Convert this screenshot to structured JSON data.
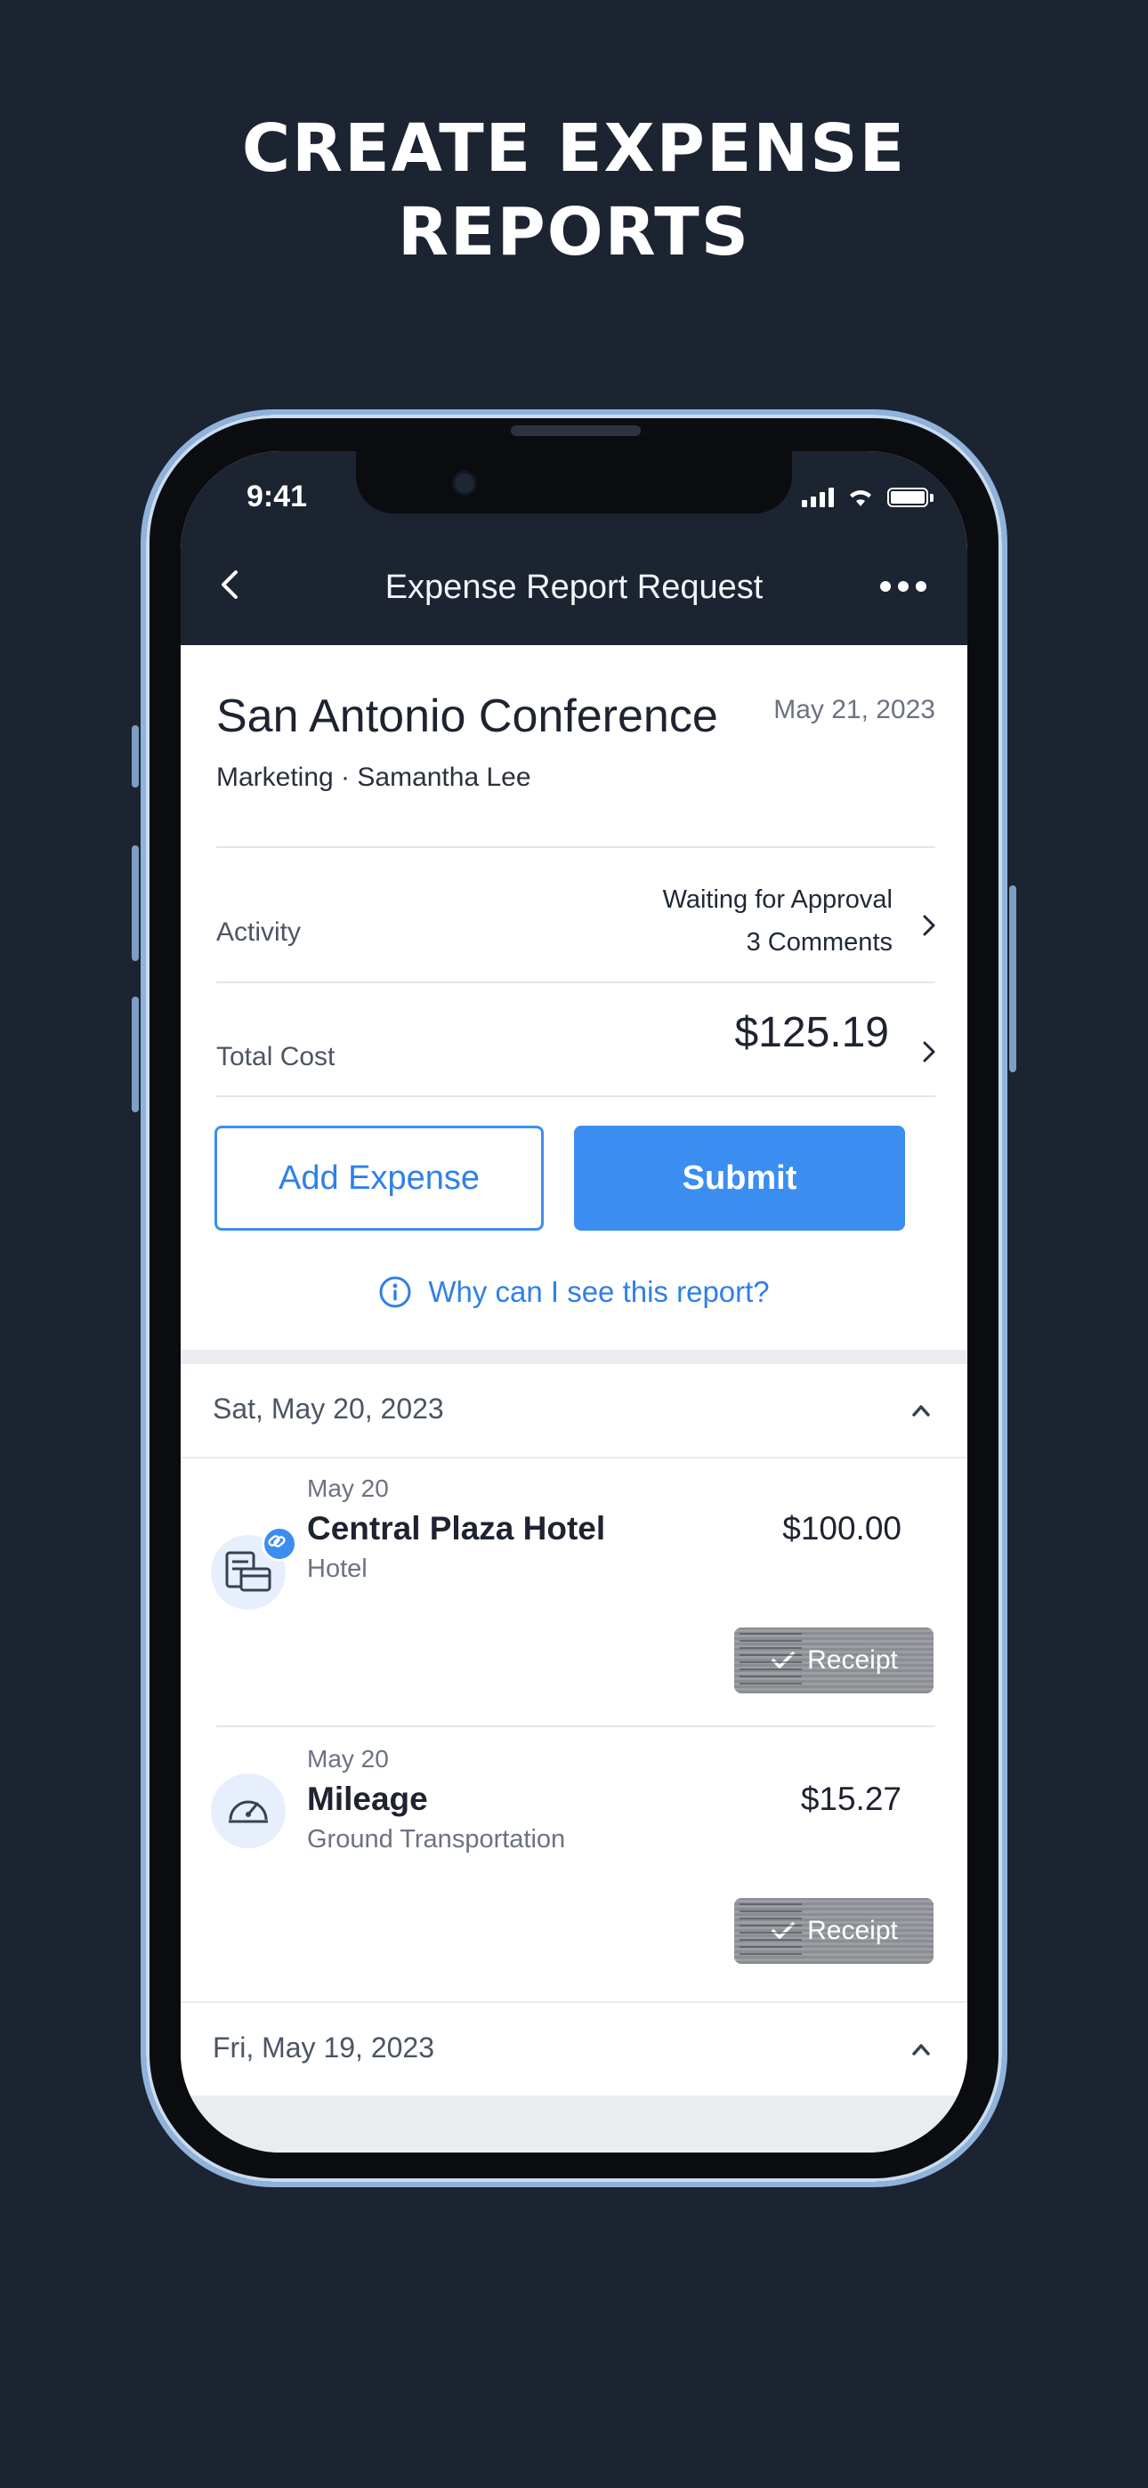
{
  "headline": {
    "line1": "CREATE EXPENSE",
    "line2": "REPORTS"
  },
  "status_bar": {
    "time": "9:41",
    "icons": [
      "cellular-signal-icon",
      "wifi-icon",
      "battery-icon"
    ]
  },
  "nav": {
    "title": "Expense Report Request",
    "back_icon": "chevron-left-icon",
    "more_icon": "ellipsis-icon"
  },
  "report": {
    "title": "San Antonio Conference",
    "date": "May 21, 2023",
    "subtitle": "Marketing · Samantha Lee",
    "activity_label": "Activity",
    "activity_status": "Waiting for Approval",
    "activity_comments": "3 Comments",
    "total_label": "Total Cost",
    "total_value": "$125.19"
  },
  "actions": {
    "add_expense": "Add Expense",
    "submit": "Submit",
    "why_link": "Why can I see this report?"
  },
  "sections": [
    {
      "date_label": "Sat, May 20, 2023",
      "expenses": [
        {
          "date": "May 20",
          "name": "Central Plaza Hotel",
          "category": "Hotel",
          "amount": "$100.00",
          "receipt": "Receipt",
          "icon": "hotel-receipt-icon"
        },
        {
          "date": "May 20",
          "name": "Mileage",
          "category": "Ground Transportation",
          "amount": "$15.27",
          "receipt": "Receipt",
          "icon": "speedometer-icon"
        }
      ]
    },
    {
      "date_label": "Fri, May 19, 2023",
      "expenses": []
    }
  ],
  "colors": {
    "background": "#1c2431",
    "accent": "#3b8ef0",
    "frame": "#8fb3dc"
  }
}
